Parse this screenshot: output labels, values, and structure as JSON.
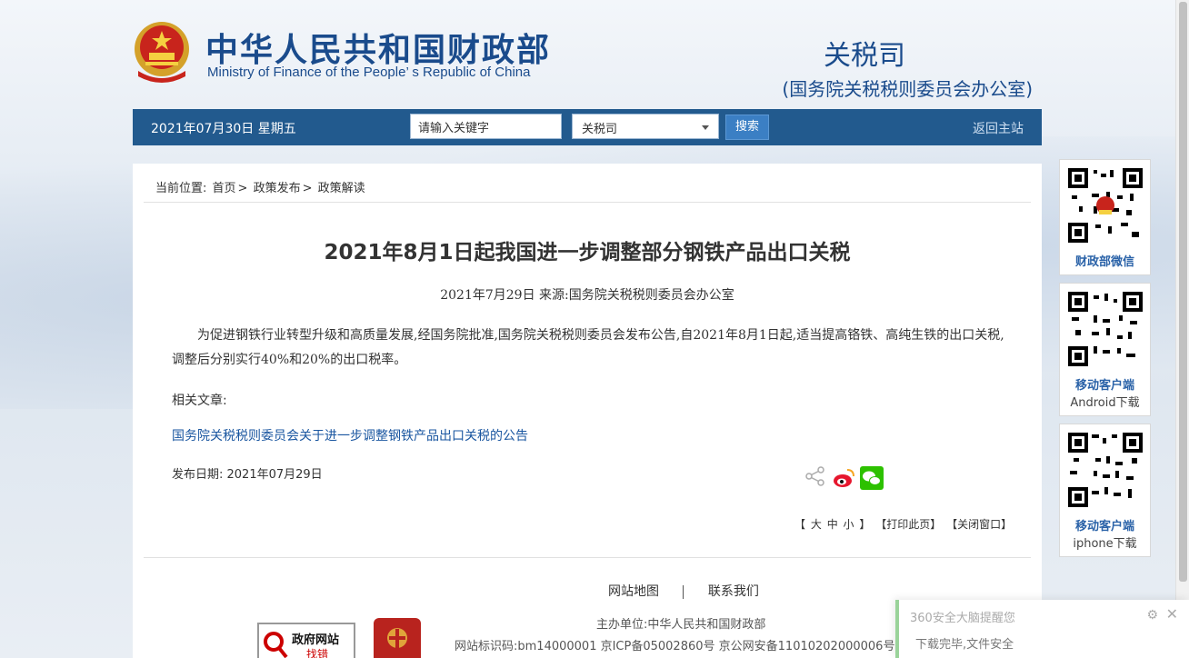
{
  "header": {
    "site_title_cn": "中华人民共和国财政部",
    "site_title_en": "Ministry of Finance of the People’ s Republic of China",
    "dept_name": "关税司",
    "dept_sub": "(国务院关税税则委员会办公室)"
  },
  "navbar": {
    "date": "2021年07月30日  星期五",
    "search_value": "请输入关键字",
    "select_value": "关税司",
    "search_button": "搜索",
    "return_link": "返回主站"
  },
  "breadcrumb": {
    "label": "当前位置:",
    "items": [
      "首页",
      "政策发布",
      "政策解读"
    ],
    "sep": ">"
  },
  "article": {
    "title": "2021年8月1日起我国进一步调整部分钢铁产品出口关税",
    "meta": "2021年7月29日  来源:国务院关税税则委员会办公室",
    "body": "为促进钢铁行业转型升级和高质量发展,经国务院批准,国务院关税税则委员会发布公告,自2021年8月1日起,适当提高铬铁、高纯生铁的出口关税,调整后分别实行40%和20%的出口税率。",
    "related_label": "相关文章:",
    "related_link": "国务院关税税则委员会关于进一步调整钢铁产品出口关税的公告",
    "pub_date": "发布日期:  2021年07月29日"
  },
  "font_controls": {
    "open": "【",
    "large": "大",
    "medium": "中",
    "small": "小",
    "close": "】",
    "print": "【打印此页】",
    "close_window": "【关闭窗口】"
  },
  "footer": {
    "sitemap": "网站地图",
    "contact": "联系我们",
    "host": "主办单位:中华人民共和国财政部",
    "ids": "网站标识码:bm14000001   京ICP备05002860号    京公网安备11010202000006号",
    "gov_badge_line1": "政府网站",
    "gov_badge_line2": "找错"
  },
  "qr": [
    {
      "line1": "财政部微信",
      "line2": ""
    },
    {
      "line1": "移动客户端",
      "line2": "Android下载"
    },
    {
      "line1": "移动客户端",
      "line2": "iphone下载"
    }
  ],
  "popup": {
    "title": "360安全大脑提醒您",
    "message": "下载完毕,文件安全"
  },
  "colors": {
    "brand_blue": "#1a4b8c",
    "nav_bg": "#225a8e",
    "link_blue": "#1a56a0"
  }
}
